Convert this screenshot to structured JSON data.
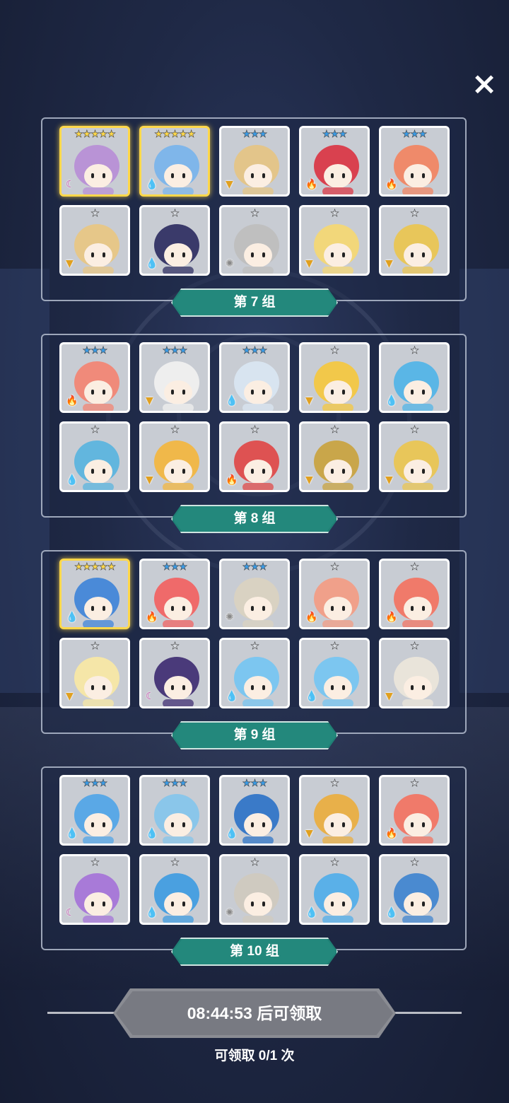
{
  "close_icon": "×",
  "groups": [
    {
      "label": "第 7 组",
      "heroes": [
        {
          "stars": "★★★★★",
          "star_color": "#ffd84a",
          "elem": "☾",
          "elem_color": "#c04aa8",
          "tint": "#b993d6",
          "gold": true
        },
        {
          "stars": "★★★★★",
          "star_color": "#ffd84a",
          "elem": "💧",
          "elem_color": "#1e78d8",
          "tint": "#7fb6ea",
          "gold": true
        },
        {
          "stars": "★★★",
          "star_color": "#3a9be6",
          "elem": "▼",
          "elem_color": "#e0a020",
          "tint": "#e3c58a",
          "gold": false
        },
        {
          "stars": "★★★",
          "star_color": "#3a9be6",
          "elem": "🔥",
          "elem_color": "#e24a2a",
          "tint": "#d9414f",
          "gold": false
        },
        {
          "stars": "★★★",
          "star_color": "#3a9be6",
          "elem": "🔥",
          "elem_color": "#e24a2a",
          "tint": "#ef8a6a",
          "gold": false
        },
        {
          "stars": "★",
          "star_color": "#d9dde3",
          "elem": "▼",
          "elem_color": "#e0a020",
          "tint": "#e6c789",
          "gold": false
        },
        {
          "stars": "★",
          "star_color": "#d9dde3",
          "elem": "💧",
          "elem_color": "#1e78d8",
          "tint": "#3a3a6a",
          "gold": false
        },
        {
          "stars": "★",
          "star_color": "#d9dde3",
          "elem": "✺",
          "elem_color": "#888888",
          "tint": "#bfbfbf",
          "gold": false
        },
        {
          "stars": "★",
          "star_color": "#d9dde3",
          "elem": "▼",
          "elem_color": "#e0a020",
          "tint": "#f2d77a",
          "gold": false
        },
        {
          "stars": "★",
          "star_color": "#d9dde3",
          "elem": "▼",
          "elem_color": "#e0a020",
          "tint": "#e8c65a",
          "gold": false
        }
      ]
    },
    {
      "label": "第 8 组",
      "heroes": [
        {
          "stars": "★★★",
          "star_color": "#3a9be6",
          "elem": "🔥",
          "elem_color": "#e24a2a",
          "tint": "#f08a7a",
          "gold": false
        },
        {
          "stars": "★★★",
          "star_color": "#3a9be6",
          "elem": "▼",
          "elem_color": "#e0a020",
          "tint": "#eeeeee",
          "gold": false
        },
        {
          "stars": "★★★",
          "star_color": "#3a9be6",
          "elem": "💧",
          "elem_color": "#1e78d8",
          "tint": "#d8e4f0",
          "gold": false
        },
        {
          "stars": "★",
          "star_color": "#d9dde3",
          "elem": "▼",
          "elem_color": "#e0a020",
          "tint": "#f2c84a",
          "gold": false
        },
        {
          "stars": "★",
          "star_color": "#d9dde3",
          "elem": "💧",
          "elem_color": "#1e78d8",
          "tint": "#5ab6e6",
          "gold": false
        },
        {
          "stars": "★",
          "star_color": "#d9dde3",
          "elem": "💧",
          "elem_color": "#1e78d8",
          "tint": "#62b6de",
          "gold": false
        },
        {
          "stars": "★",
          "star_color": "#d9dde3",
          "elem": "▼",
          "elem_color": "#e0a020",
          "tint": "#f0b84a",
          "gold": false
        },
        {
          "stars": "★",
          "star_color": "#d9dde3",
          "elem": "🔥",
          "elem_color": "#e24a2a",
          "tint": "#de5252",
          "gold": false
        },
        {
          "stars": "★",
          "star_color": "#d9dde3",
          "elem": "▼",
          "elem_color": "#e0a020",
          "tint": "#c9a64a",
          "gold": false
        },
        {
          "stars": "★",
          "star_color": "#d9dde3",
          "elem": "▼",
          "elem_color": "#e0a020",
          "tint": "#e8c65a",
          "gold": false
        }
      ]
    },
    {
      "label": "第 9 组",
      "heroes": [
        {
          "stars": "★★★★★",
          "star_color": "#ffd84a",
          "elem": "💧",
          "elem_color": "#1e78d8",
          "tint": "#4a8ad8",
          "gold": true
        },
        {
          "stars": "★★★",
          "star_color": "#3a9be6",
          "elem": "🔥",
          "elem_color": "#e24a2a",
          "tint": "#ef6a6a",
          "gold": false
        },
        {
          "stars": "★★★",
          "star_color": "#3a9be6",
          "elem": "✺",
          "elem_color": "#888888",
          "tint": "#d9d2c2",
          "gold": false
        },
        {
          "stars": "★",
          "star_color": "#d9dde3",
          "elem": "🔥",
          "elem_color": "#e24a2a",
          "tint": "#f0a08a",
          "gold": false
        },
        {
          "stars": "★",
          "star_color": "#d9dde3",
          "elem": "🔥",
          "elem_color": "#e24a2a",
          "tint": "#f07a6a",
          "gold": false
        },
        {
          "stars": "★",
          "star_color": "#d9dde3",
          "elem": "▼",
          "elem_color": "#e0a020",
          "tint": "#f5e6a8",
          "gold": false
        },
        {
          "stars": "★",
          "star_color": "#d9dde3",
          "elem": "☾",
          "elem_color": "#c04aa8",
          "tint": "#4a3a7a",
          "gold": false
        },
        {
          "stars": "★",
          "star_color": "#d9dde3",
          "elem": "💧",
          "elem_color": "#1e78d8",
          "tint": "#7cc6f0",
          "gold": false
        },
        {
          "stars": "★",
          "star_color": "#d9dde3",
          "elem": "💧",
          "elem_color": "#1e78d8",
          "tint": "#7cc6f0",
          "gold": false
        },
        {
          "stars": "★",
          "star_color": "#d9dde3",
          "elem": "▼",
          "elem_color": "#e0a020",
          "tint": "#e9e4da",
          "gold": false
        }
      ]
    },
    {
      "label": "第 10 组",
      "heroes": [
        {
          "stars": "★★★",
          "star_color": "#3a9be6",
          "elem": "💧",
          "elem_color": "#1e78d8",
          "tint": "#5aa8e6",
          "gold": false
        },
        {
          "stars": "★★★",
          "star_color": "#3a9be6",
          "elem": "💧",
          "elem_color": "#1e78d8",
          "tint": "#8ac6ea",
          "gold": false
        },
        {
          "stars": "★★★",
          "star_color": "#3a9be6",
          "elem": "💧",
          "elem_color": "#1e78d8",
          "tint": "#3a7ac8",
          "gold": false
        },
        {
          "stars": "★",
          "star_color": "#d9dde3",
          "elem": "▼",
          "elem_color": "#e0a020",
          "tint": "#e8b04a",
          "gold": false
        },
        {
          "stars": "★",
          "star_color": "#d9dde3",
          "elem": "🔥",
          "elem_color": "#e24a2a",
          "tint": "#f07a6a",
          "gold": false
        },
        {
          "stars": "★",
          "star_color": "#d9dde3",
          "elem": "☾",
          "elem_color": "#c04aa8",
          "tint": "#a87ad8",
          "gold": false
        },
        {
          "stars": "★",
          "star_color": "#d9dde3",
          "elem": "💧",
          "elem_color": "#1e78d8",
          "tint": "#4aa0e0",
          "gold": false
        },
        {
          "stars": "★",
          "star_color": "#d9dde3",
          "elem": "✺",
          "elem_color": "#888888",
          "tint": "#cfcac0",
          "gold": false
        },
        {
          "stars": "★",
          "star_color": "#d9dde3",
          "elem": "💧",
          "elem_color": "#1e78d8",
          "tint": "#5ab0e8",
          "gold": false
        },
        {
          "stars": "★",
          "star_color": "#d9dde3",
          "elem": "💧",
          "elem_color": "#1e78d8",
          "tint": "#4a8ad0",
          "gold": false
        }
      ]
    }
  ],
  "claim": {
    "button_label": "08:44:53 后可领取",
    "count_text": "可领取 0/1 次"
  }
}
